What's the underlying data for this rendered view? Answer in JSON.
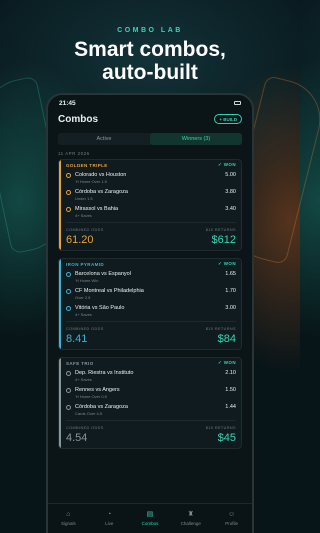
{
  "hero": {
    "eyebrow": "COMBO LAB",
    "headline_1": "Smart combos,",
    "headline_2": "auto-built"
  },
  "status": {
    "time": "21:45"
  },
  "header": {
    "title": "Combos",
    "build_label": "+ BUILD"
  },
  "tabs": [
    {
      "label": "Active"
    },
    {
      "label": "Winners (3)"
    }
  ],
  "date": "11 APR 2026",
  "cards": [
    {
      "name": "GOLDEN TRIPLE",
      "accent": "#e8a23a",
      "status": "✓ WON",
      "legs": [
        {
          "match": "Colorado vs Houston",
          "sub": "'H Home Over 1.5",
          "odds": "5.00"
        },
        {
          "match": "Córdoba vs Zaragoza",
          "sub": "Under 1.5",
          "odds": "3.80"
        },
        {
          "match": "Mirassol vs Bahia",
          "sub": "4+ Saves",
          "odds": "3.40"
        }
      ],
      "combined_label": "COMBINED ODDS",
      "combined": "61.20",
      "returns_label": "$10 RETURNS",
      "returns": "$612"
    },
    {
      "name": "IRON PYRAMID",
      "accent": "#3ab3d6",
      "status": "✓ WON",
      "legs": [
        {
          "match": "Barcelona vs Espanyol",
          "sub": "'H Home Win",
          "odds": "1.65"
        },
        {
          "match": "CF Montreal vs Philadelphia",
          "sub": "Over 2.5",
          "odds": "1.70"
        },
        {
          "match": "Vitória vs São Paulo",
          "sub": "4+ Saves",
          "odds": "3.00"
        }
      ],
      "combined_label": "COMBINED ODDS",
      "combined": "8.41",
      "returns_label": "$10 RETURNS",
      "returns": "$84"
    },
    {
      "name": "SAFE TRIO",
      "accent": "#8a9599",
      "status": "✓ WON",
      "legs": [
        {
          "match": "Dep. Riestra vs Instituto",
          "sub": "4+ Saves",
          "odds": "2.10"
        },
        {
          "match": "Rennes vs Angers",
          "sub": "'H Home Over 0.5",
          "odds": "1.50"
        },
        {
          "match": "Córdoba vs Zaragoza",
          "sub": "Cards Over 4.5",
          "odds": "1.44"
        }
      ],
      "combined_label": "COMBINED ODDS",
      "combined": "4.54",
      "returns_label": "$10 RETURNS",
      "returns": "$45"
    }
  ],
  "nav": [
    {
      "label": "Signals",
      "icon": "⌂"
    },
    {
      "label": "Live",
      "icon": "◔"
    },
    {
      "label": "Combos",
      "icon": "▤"
    },
    {
      "label": "Challenge",
      "icon": "♜"
    },
    {
      "label": "Profile",
      "icon": "☺"
    }
  ],
  "colors": {
    "accent": "#35d6b3",
    "gold": "#e8a23a",
    "blue": "#3ab3d6",
    "grey": "#8a9599"
  }
}
